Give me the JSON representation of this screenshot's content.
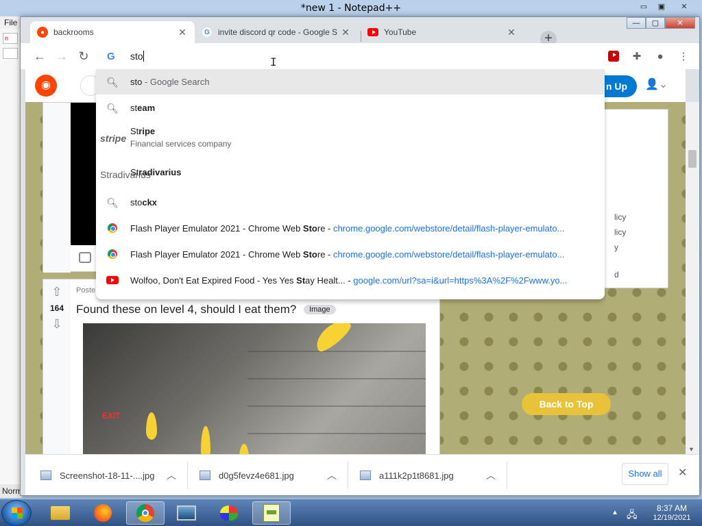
{
  "notepad": {
    "title": "*new 1 - Notepad++",
    "menu_file": "File",
    "status_left": "Norm",
    "mini_tab_1": "n",
    "ctrl_min": "▭",
    "ctrl_max": "▣",
    "ctrl_close": "✕"
  },
  "chrome": {
    "win_min": "—",
    "win_max": "▢",
    "win_close": "✕",
    "tabs": [
      {
        "label": "backrooms",
        "close": "✕"
      },
      {
        "label": "invite discord qr code - Google S",
        "close": "✕"
      },
      {
        "label": "YouTube",
        "close": "✕"
      }
    ],
    "new_tab": "+",
    "nav": {
      "back": "←",
      "forward": "→",
      "reload": "↻"
    }
  },
  "omnibox": {
    "g_logo": "G",
    "query": "sto",
    "suggestions": [
      {
        "bold": "",
        "plain": "sto",
        "rest": " - Google Search",
        "type": "search"
      },
      {
        "plain": "st",
        "bold": "eam",
        "type": "search"
      },
      {
        "plain": "St",
        "bold": "ripe",
        "subtitle": "Financial services company",
        "logo": "stripe",
        "type": "entity"
      },
      {
        "plain": "St",
        "bold": "radivarius",
        "logo": "Stradivarius",
        "type": "entity"
      },
      {
        "plain": "sto",
        "bold": "ckx",
        "type": "search"
      },
      {
        "pre": "Flash Player Emulator 2021 - Chrome Web ",
        "bold": "Sto",
        "post": "re",
        "sep": " - ",
        "url": "chrome.google.com/webstore/detail/flash-player-emulato...",
        "type": "history"
      },
      {
        "pre": "Flash Player Emulator 2021 - Chrome Web ",
        "bold": "Sto",
        "post": "re",
        "sep": " - ",
        "url": "chrome.google.com/webstore/detail/flash-player-emulato...",
        "type": "history"
      },
      {
        "pre": "Wolfoo, Don't Eat Expired Food - Yes Yes ",
        "bold": "St",
        "post": "ay Healt...",
        "sep": " - ",
        "url": "google.com/url?sa=i&url=https%3A%2F%2Fwww.yo...",
        "type": "youtube"
      }
    ]
  },
  "reddit": {
    "signup_label": "n Up",
    "post": {
      "score": "164",
      "meta": "Poste",
      "title": "Found these on level 4, should I eat them?",
      "flair": "Image",
      "exit_sign": "EXIT"
    },
    "sidebar": {
      "line1": "licy",
      "line2": "licy",
      "line3": "y",
      "line4": "d"
    },
    "back_to_top": "Back to Top"
  },
  "downloads": {
    "items": [
      {
        "name": "Screenshot-18-11-....jpg"
      },
      {
        "name": "d0g5fevz4e681.jpg"
      },
      {
        "name": "a111k2p1t8681.jpg"
      }
    ],
    "show_all": "Show all",
    "close": "✕"
  },
  "taskbar": {
    "time": "8:37 AM",
    "date": "12/19/2021",
    "tray_arrow": "▲"
  },
  "colors": {
    "reddit_orange": "#ff4500",
    "reddit_blue": "#0079d3",
    "chrome_link": "#1a73e8",
    "back_to_top": "#e8c33a"
  }
}
